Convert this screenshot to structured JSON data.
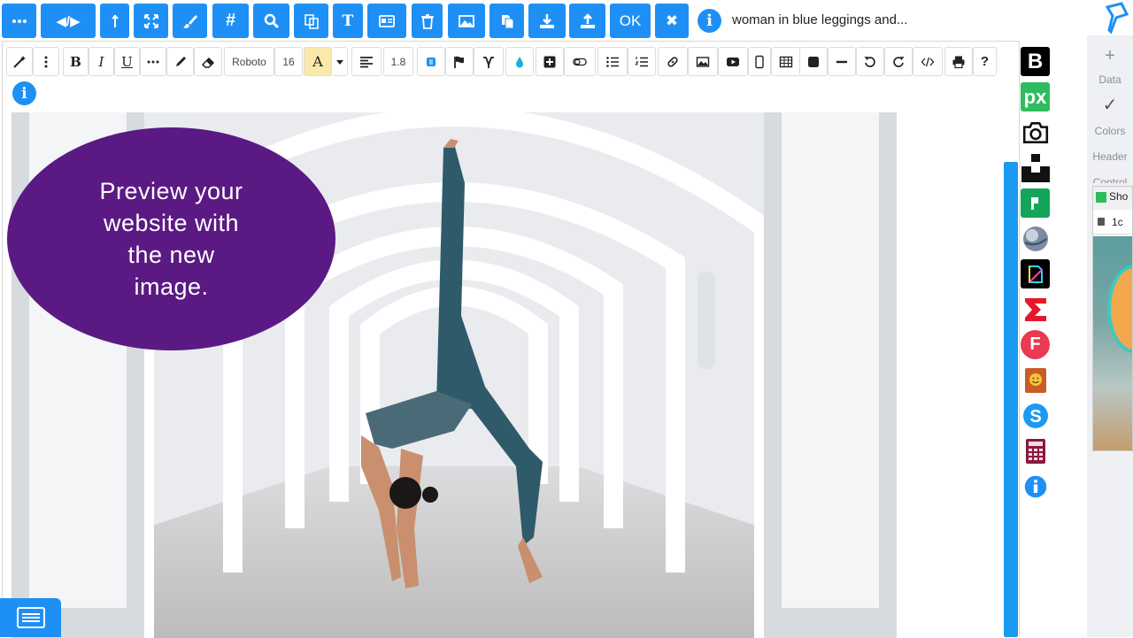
{
  "topbar": {
    "buttons": [
      {
        "name": "more-icon",
        "label": "···"
      },
      {
        "name": "code-toggle",
        "label": "◀/▶"
      },
      {
        "name": "unlink-icon",
        "label": ""
      },
      {
        "name": "fullscreen-icon",
        "label": ""
      },
      {
        "name": "brush-icon",
        "label": ""
      },
      {
        "name": "hash-icon",
        "label": "#"
      },
      {
        "name": "search-icon",
        "label": ""
      },
      {
        "name": "translate-icon",
        "label": ""
      },
      {
        "name": "text-icon",
        "label": "T"
      },
      {
        "name": "card-icon",
        "label": ""
      },
      {
        "name": "trash-icon",
        "label": ""
      },
      {
        "name": "image-icon",
        "label": ""
      },
      {
        "name": "copy-icon",
        "label": ""
      },
      {
        "name": "download-icon",
        "label": ""
      },
      {
        "name": "upload-icon",
        "label": ""
      },
      {
        "name": "ok-button",
        "label": "OK"
      },
      {
        "name": "close-icon",
        "label": "✖"
      }
    ],
    "info_label": "i",
    "caption": "woman in blue leggings and..."
  },
  "format_bar": {
    "bold": "B",
    "italic": "I",
    "underline": "U",
    "font_family": "Roboto",
    "font_size": "16",
    "font_color": "A",
    "line_height": "1.8",
    "help": "?"
  },
  "editor": {
    "info_label": "i",
    "callout_text": "Preview your website with the new image."
  },
  "plugins": {
    "b_label": "B",
    "px_label": "px",
    "f_label": "F"
  },
  "side_panel": {
    "plus": "+",
    "data": "Data",
    "check": "✓",
    "colors": "Colors",
    "header": "Header",
    "control": "Control",
    "window_tab": "Sho",
    "window_url": "1c"
  },
  "colors": {
    "accent": "#1e90f5",
    "callout": "#5b1a83"
  }
}
